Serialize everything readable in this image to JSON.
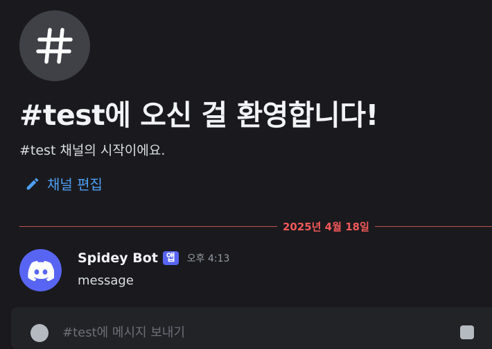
{
  "welcome": {
    "title": "#test에 오신 걸 환영합니다!",
    "subtitle": "#test 채널의 시작이에요.",
    "edit_label": "채널 편집"
  },
  "divider": {
    "date": "2025년 4월 18일",
    "color": "#f25858"
  },
  "message": {
    "username": "Spidey Bot",
    "badge": "앱",
    "timestamp": "오후 4:13",
    "content": "message"
  },
  "composer": {
    "placeholder": "#test에 메시지 보내기"
  },
  "icons": {
    "channel": "hashtag-icon",
    "edit": "pencil-icon",
    "avatar": "discord-logo-icon",
    "attach": "plus-circle-icon",
    "gift": "gift-icon"
  },
  "colors": {
    "accent": "#5865f2",
    "link": "#4e9ff5",
    "background": "#1a1a1e"
  }
}
